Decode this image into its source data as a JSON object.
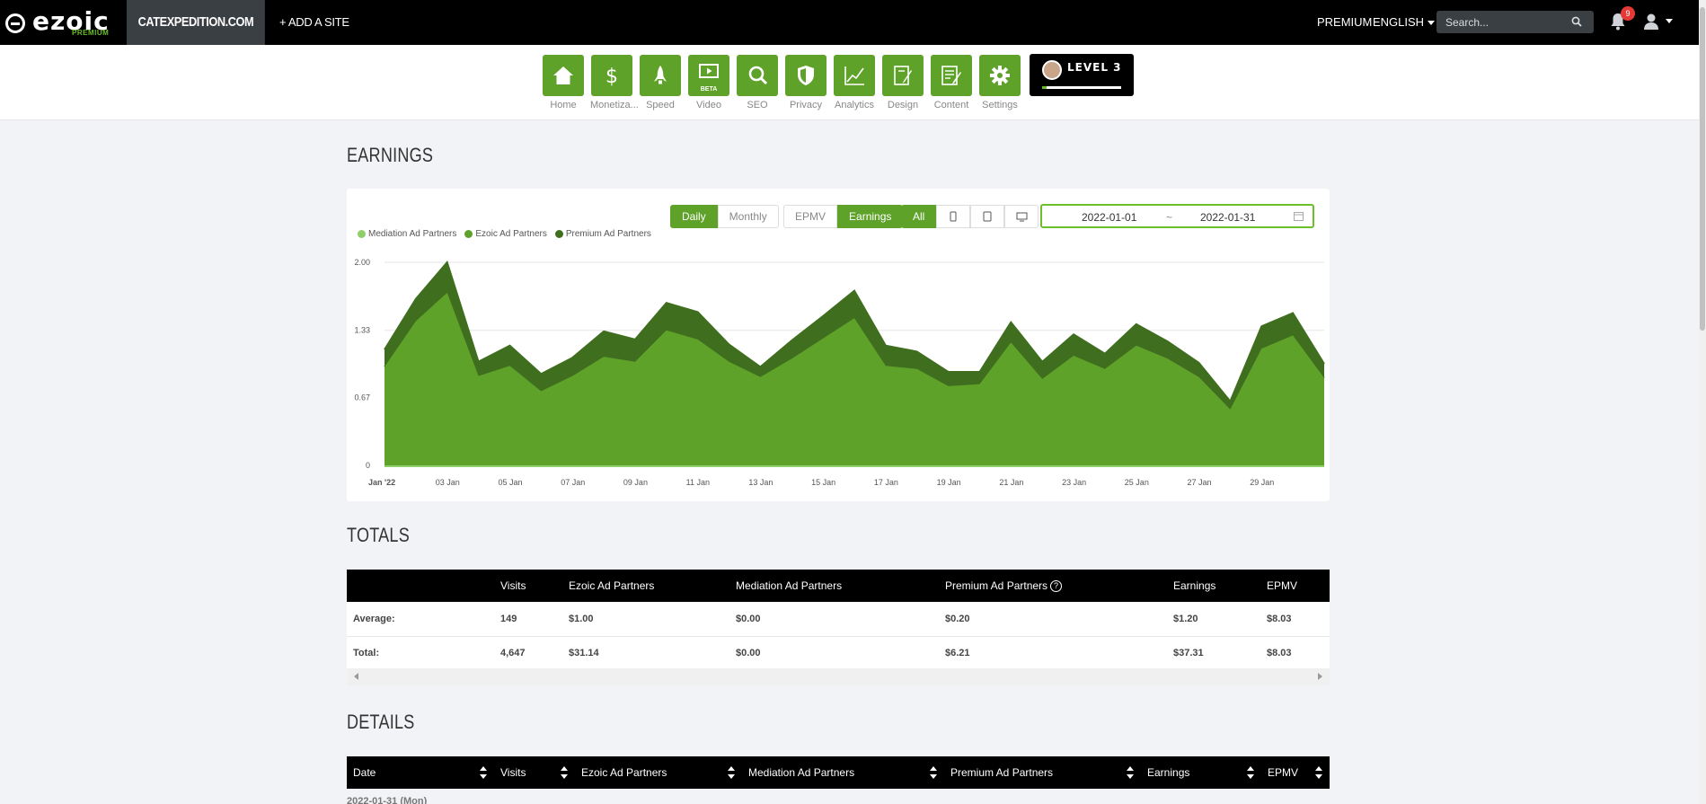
{
  "topbar": {
    "logo_text": "ezoic",
    "logo_sub": "PREMIUM",
    "site_name": "CATEXPEDITION.COM",
    "add_site": "+ ADD A SITE",
    "premium": "PREMIUM",
    "language": "ENGLISH",
    "search_placeholder": "Search...",
    "notification_count": "9"
  },
  "nav": {
    "items": [
      {
        "label": "Home",
        "icon": "home-icon"
      },
      {
        "label": "Monetiza...",
        "icon": "dollar-icon"
      },
      {
        "label": "Speed",
        "icon": "rocket-icon"
      },
      {
        "label": "Video",
        "icon": "video-icon",
        "badge": "BETA"
      },
      {
        "label": "SEO",
        "icon": "magnifier-icon"
      },
      {
        "label": "Privacy",
        "icon": "shield-icon"
      },
      {
        "label": "Analytics",
        "icon": "line-chart-icon"
      },
      {
        "label": "Design",
        "icon": "design-icon"
      },
      {
        "label": "Content",
        "icon": "content-icon"
      },
      {
        "label": "Settings",
        "icon": "gear-icon"
      }
    ],
    "level_label": "LEVEL 3"
  },
  "earnings": {
    "heading": "EARNINGS",
    "period_buttons": [
      "Daily",
      "Monthly"
    ],
    "metric_buttons": [
      "EPMV",
      "Earnings"
    ],
    "device_all": "All",
    "date_start": "2022-01-01",
    "date_sep": "~",
    "date_end": "2022-01-31",
    "legend": [
      "Mediation Ad Partners",
      "Ezoic Ad Partners",
      "Premium Ad Partners"
    ]
  },
  "chart_data": {
    "type": "area",
    "title": "",
    "x_tick_labels": [
      "Jan '22",
      "03 Jan",
      "05 Jan",
      "07 Jan",
      "09 Jan",
      "11 Jan",
      "13 Jan",
      "15 Jan",
      "17 Jan",
      "19 Jan",
      "21 Jan",
      "23 Jan",
      "25 Jan",
      "27 Jan",
      "29 Jan"
    ],
    "y_tick_labels": [
      "2.00",
      "1.33",
      "0.67",
      "0"
    ],
    "ylim": [
      0,
      2.0
    ],
    "x": [
      "2022-01-01",
      "2022-01-02",
      "2022-01-03",
      "2022-01-04",
      "2022-01-05",
      "2022-01-06",
      "2022-01-07",
      "2022-01-08",
      "2022-01-09",
      "2022-01-10",
      "2022-01-11",
      "2022-01-12",
      "2022-01-13",
      "2022-01-14",
      "2022-01-15",
      "2022-01-16",
      "2022-01-17",
      "2022-01-18",
      "2022-01-19",
      "2022-01-20",
      "2022-01-21",
      "2022-01-22",
      "2022-01-23",
      "2022-01-24",
      "2022-01-25",
      "2022-01-26",
      "2022-01-27",
      "2022-01-28",
      "2022-01-29",
      "2022-01-30",
      "2022-01-31"
    ],
    "stacked": true,
    "series": [
      {
        "name": "Mediation Ad Partners",
        "color": "#8fcf6a",
        "values": [
          0,
          0,
          0,
          0,
          0,
          0,
          0,
          0,
          0,
          0,
          0,
          0,
          0,
          0,
          0,
          0,
          0,
          0,
          0,
          0,
          0,
          0,
          0,
          0,
          0,
          0,
          0,
          0,
          0,
          0,
          0
        ]
      },
      {
        "name": "Ezoic Ad Partners",
        "color": "#5fa22a",
        "values": [
          0.97,
          1.42,
          1.7,
          0.88,
          0.98,
          0.73,
          0.88,
          1.07,
          1.02,
          1.33,
          1.24,
          1.02,
          0.87,
          1.05,
          1.25,
          1.45,
          0.98,
          0.95,
          0.78,
          0.8,
          1.21,
          0.85,
          1.08,
          0.95,
          1.18,
          1.05,
          0.87,
          0.55,
          1.15,
          1.28,
          0.86
        ]
      },
      {
        "name": "Premium Ad Partners",
        "color": "#3f6e1f",
        "values": [
          0.17,
          0.22,
          0.3,
          0.14,
          0.2,
          0.17,
          0.18,
          0.25,
          0.22,
          0.27,
          0.27,
          0.17,
          0.1,
          0.18,
          0.22,
          0.27,
          0.2,
          0.17,
          0.14,
          0.12,
          0.2,
          0.17,
          0.21,
          0.15,
          0.21,
          0.17,
          0.14,
          0.08,
          0.22,
          0.22,
          0.14
        ]
      }
    ],
    "legend_position": "top-left",
    "grid": true
  },
  "totals": {
    "heading": "TOTALS",
    "columns": [
      "",
      "Visits",
      "Ezoic Ad Partners",
      "Mediation Ad Partners",
      "Premium Ad Partners",
      "Earnings",
      "EPMV"
    ],
    "rows": [
      [
        "Average:",
        "149",
        "$1.00",
        "$0.00",
        "$0.20",
        "$1.20",
        "$8.03"
      ],
      [
        "Total:",
        "4,647",
        "$31.14",
        "$0.00",
        "$6.21",
        "$37.31",
        "$8.03"
      ]
    ],
    "help_glyph": "?"
  },
  "details": {
    "heading": "DETAILS",
    "columns": [
      "Date",
      "Visits",
      "Ezoic Ad Partners",
      "Mediation Ad Partners",
      "Premium Ad Partners",
      "Earnings",
      "EPMV"
    ],
    "partial_row": "2022-01-31 (Mon)"
  }
}
